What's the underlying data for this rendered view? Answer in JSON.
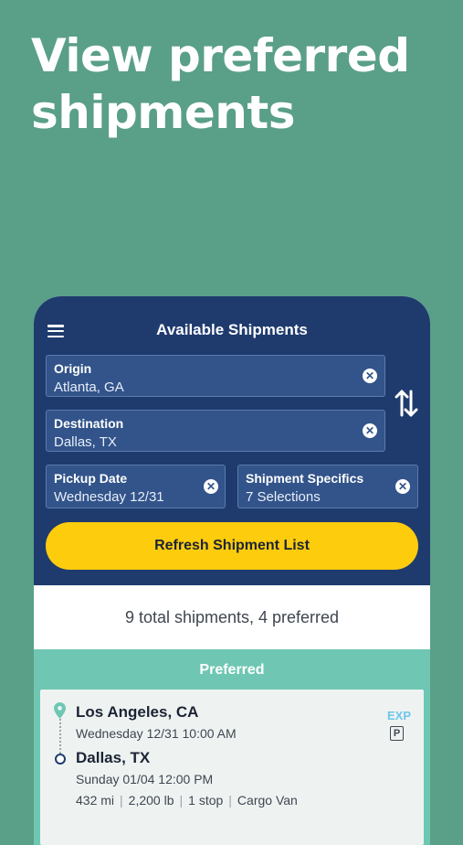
{
  "headline": "View preferred shipments",
  "header": {
    "title": "Available Shipments"
  },
  "filters": {
    "origin": {
      "label": "Origin",
      "value": "Atlanta, GA"
    },
    "destination": {
      "label": "Destination",
      "value": "Dallas, TX"
    },
    "pickup_date": {
      "label": "Pickup Date",
      "value": "Wednesday 12/31"
    },
    "shipment_specifics": {
      "label": "Shipment Specifics",
      "value": "7 Selections"
    },
    "clear_icon": "✕"
  },
  "refresh_button": "Refresh Shipment List",
  "summary": "9 total shipments, 4 preferred",
  "preferred_section": {
    "title": "Preferred",
    "shipments": [
      {
        "origin_city": "Los Angeles, CA",
        "origin_time": "Wednesday 12/31 10:00 AM",
        "destination_city": "Dallas, TX",
        "destination_time": "Sunday 01/04 12:00 PM",
        "distance": "432 mi",
        "weight": "2,200 lb",
        "stops": "1 stop",
        "vehicle": "Cargo Van",
        "badge_exp": "EXP",
        "badge_p": "P"
      }
    ]
  },
  "colors": {
    "background": "#5a9f88",
    "header_navy": "#1f3b6e",
    "accent_yellow": "#fdcc0d",
    "preferred_teal": "#6fc7b3",
    "exp_blue": "#6fc6e8"
  },
  "icons": {
    "menu": "hamburger-menu-icon",
    "swap": "swap-arrows-icon",
    "clear": "clear-circle-icon",
    "origin": "location-pin-icon",
    "destination": "destination-dot-icon",
    "parking": "p-badge-icon"
  }
}
